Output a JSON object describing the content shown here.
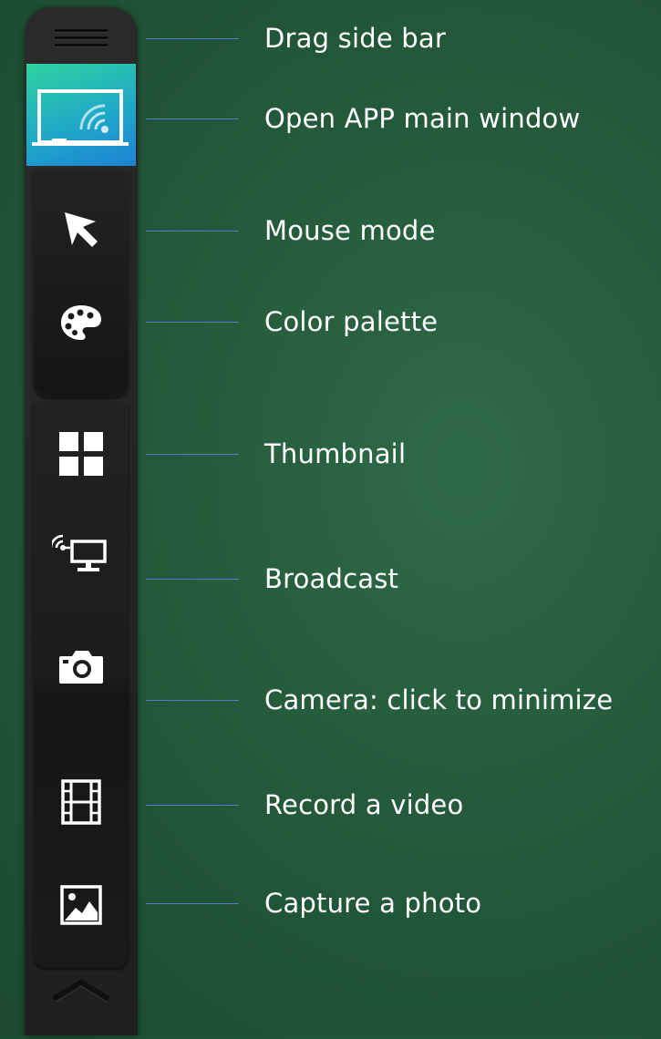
{
  "sidebar": {
    "tools": [
      {
        "name": "drag-handle",
        "icon": "drag-handle-icon",
        "label": "Drag side bar"
      },
      {
        "name": "open-app",
        "icon": "whiteboard-wifi-icon",
        "label": "Open APP main window"
      },
      {
        "name": "mouse-mode",
        "icon": "cursor-arrow-icon",
        "label": "Mouse mode"
      },
      {
        "name": "color-palette",
        "icon": "palette-icon",
        "label": "Color palette"
      },
      {
        "name": "thumbnail",
        "icon": "grid-icon",
        "label": "Thumbnail"
      },
      {
        "name": "broadcast",
        "icon": "monitor-wifi-icon",
        "label": "Broadcast"
      },
      {
        "name": "camera",
        "icon": "camera-icon",
        "label": "Camera: click to  minimize"
      },
      {
        "name": "record-video",
        "icon": "film-icon",
        "label": "Record a video"
      },
      {
        "name": "capture-photo",
        "icon": "image-icon",
        "label": "Capture a photo"
      }
    ],
    "collapse_icon": "chevron-up-icon"
  },
  "colors": {
    "background": "#245a3b",
    "sidebar": "#222222",
    "accent_start": "#2fd39f",
    "accent_end": "#1d82d3",
    "connector": "#4f7fc4",
    "label": "#ffffff"
  }
}
